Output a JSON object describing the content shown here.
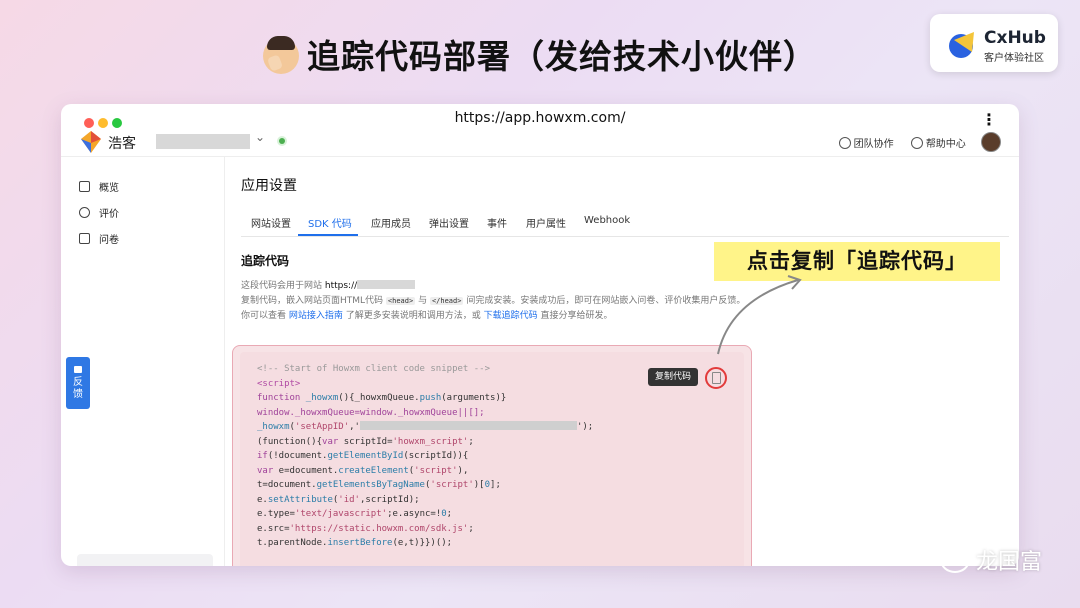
{
  "slide": {
    "title": "追踪代码部署（发给技术小伙伴）",
    "callout": "点击复制「追踪代码」",
    "watermark": "龙国富"
  },
  "brand": {
    "name": "CxHub",
    "subtitle": "客户体验社区"
  },
  "browser": {
    "url": "https://app.howxm.com/"
  },
  "app": {
    "name": "浩客",
    "team_label": "团队协作",
    "help_label": "帮助中心"
  },
  "sidebar": {
    "items": [
      {
        "label": "概览"
      },
      {
        "label": "评价"
      },
      {
        "label": "问卷"
      }
    ]
  },
  "feedback_label": "反馈",
  "main": {
    "page_title": "应用设置",
    "tabs": [
      {
        "label": "网站设置"
      },
      {
        "label": "SDK 代码"
      },
      {
        "label": "应用成员"
      },
      {
        "label": "弹出设置"
      },
      {
        "label": "事件"
      },
      {
        "label": "用户属性"
      },
      {
        "label": "Webhook"
      }
    ],
    "section_title": "追踪代码",
    "desc": {
      "p1_a": "这段代码会用于网站 ",
      "p1_url": "https://",
      "p2_a": "复制代码，嵌入网站页面HTML代码 ",
      "p2_head": "<head>",
      "p2_b": " 与 ",
      "p2_endhead": "</head>",
      "p2_c": " 间完成安装。安装成功后，即可在网站嵌入问卷、评价收集用户反馈。",
      "p3_a": "你可以查看 ",
      "p3_link1": "网站接入指南",
      "p3_b": " 了解更多安装说明和调用方法，或 ",
      "p3_link2": "下载追踪代码",
      "p3_c": " 直接分享给研发。"
    },
    "copy_tooltip": "复制代码",
    "code": {
      "l1": "<!-- Start of Howxm client code snippet -->",
      "l2": "<script>",
      "l3_kw": "function",
      "l3_fn": " _howxm",
      "l3_a": "(){_howxmQueue.",
      "l3_fn2": "push",
      "l3_b": "(arguments)}",
      "l4": "window._howxmQueue=window._howxmQueue||[];",
      "l5_fn": "_howxm",
      "l5_a": "(",
      "l5_s1": "'setAppID'",
      "l5_b": ",'",
      "l5_c": "');",
      "l6_a": "(function(){",
      "l6_kw": "var",
      "l6_b": " scriptId=",
      "l6_s": "'howxm_script'",
      "l6_c": ";",
      "l7_kw": "if",
      "l7_a": "(!document.",
      "l7_fn": "getElementById",
      "l7_b": "(scriptId)){",
      "l8_kw": "var",
      "l8_a": " e=document.",
      "l8_fn": "createElement",
      "l8_b": "(",
      "l8_s": "'script'",
      "l8_c": "),",
      "l9_a": "t=document.",
      "l9_fn": "getElementsByTagName",
      "l9_b": "(",
      "l9_s": "'script'",
      "l9_c": ")[",
      "l9_n": "0",
      "l9_d": "];",
      "l10_a": "e.",
      "l10_fn": "setAttribute",
      "l10_b": "(",
      "l10_s": "'id'",
      "l10_c": ",scriptId);",
      "l11_a": "e.type=",
      "l11_s": "'text/javascript'",
      "l11_b": ";e.async=!",
      "l11_n": "0",
      "l11_c": ";",
      "l12_a": "e.src=",
      "l12_s": "'https://static.howxm.com/sdk.js'",
      "l12_b": ";",
      "l13_a": "t.parentNode.",
      "l13_fn": "insertBefore",
      "l13_b": "(e,t)}})();"
    }
  },
  "colors": {
    "accent": "#1f6feb",
    "callout_bg": "#fff489",
    "highlight_red": "#e23b3b",
    "feedback_bg": "#2f78e4"
  },
  "icons": [
    "home-icon",
    "chat-icon",
    "clipboard-icon",
    "team-icon",
    "help-icon",
    "copy-icon",
    "wechat-icon"
  ]
}
